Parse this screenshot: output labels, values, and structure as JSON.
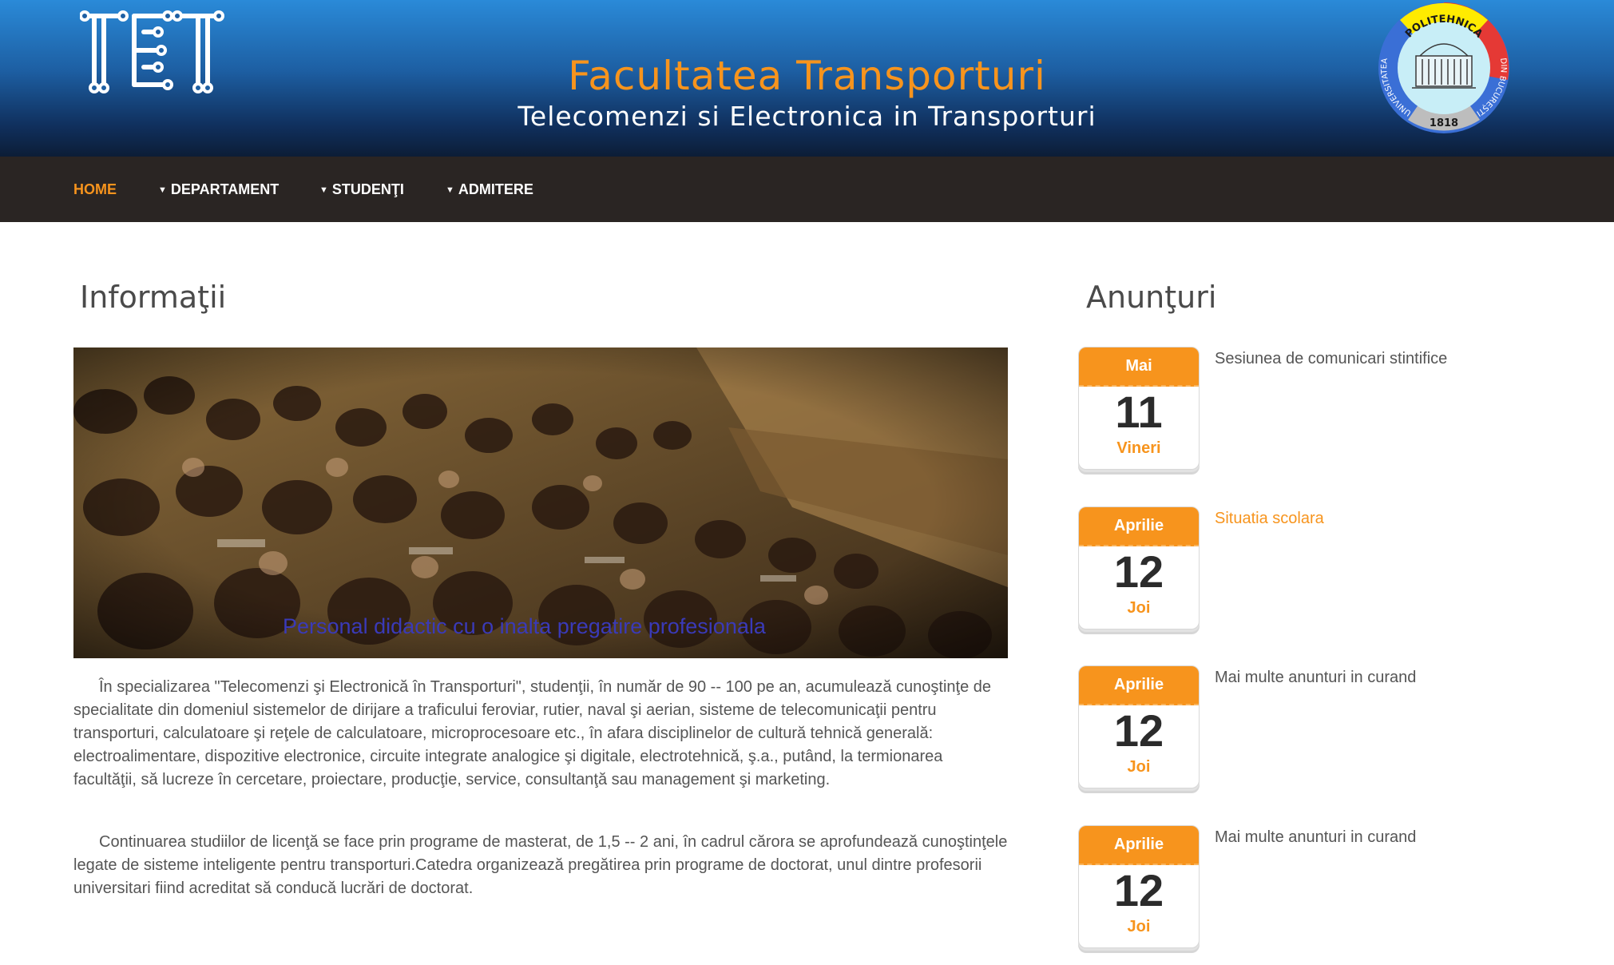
{
  "header": {
    "title": "Facultatea Transporturi",
    "subtitle": "Telecomenzi si Electronica in Transporturi",
    "seal": {
      "top_text": "POLITEHNICA",
      "left_text": "UNIVERSITATEA",
      "right_text": "DIN BUCUREȘTI",
      "year": "1818"
    }
  },
  "nav": {
    "items": [
      {
        "label": "HOME",
        "active": true
      },
      {
        "label": "DEPARTAMENT",
        "caret": true
      },
      {
        "label": "STUDENŢI",
        "caret": true
      },
      {
        "label": "ADMITERE",
        "caret": true
      }
    ]
  },
  "main": {
    "title": "Informaţii",
    "hero_caption": "Personal didactic cu o inalta pregatire profesionala",
    "paragraphs": [
      "În specializarea \"Telecomenzi şi Electronică în Transporturi\", studenţii, în număr de 90 -- 100 pe an, acumulează cunoştinţe de specialitate din domeniul sistemelor de dirijare a traficului feroviar, rutier, naval şi aerian, sisteme de telecomunicaţii pentru transporturi, calculatoare şi reţele de calculatoare, microprocesoare etc., în afara disciplinelor de cultură tehnică generală: electroalimentare, dispozitive electronice, circuite integrate analogice şi digitale, electrotehnică, ş.a., putând, la termionarea facultăţii, să lucreze în cercetare, proiectare, producţie, service, consultanţă sau management şi marketing.",
      "Continuarea studiilor de licenţă se face prin programe de masterat, de 1,5 -- 2 ani, în cadrul cărora se aprofundează cunoştinţele legate de sisteme inteligente pentru transporturi.Catedra organizează pregătirea prin programe de doctorat, unul dintre profesorii universitari fiind acreditat să conducă lucrări de doctorat."
    ]
  },
  "sidebar": {
    "title": "Anunţuri",
    "announcements": [
      {
        "month": "Mai",
        "day": "11",
        "weekday": "Vineri",
        "text": "Sesiunea de comunicari stintifice"
      },
      {
        "month": "Aprilie",
        "day": "12",
        "weekday": "Joi",
        "text": "Situatia scolara"
      },
      {
        "month": "Aprilie",
        "day": "12",
        "weekday": "Joi",
        "text": "Mai multe anunturi in curand"
      },
      {
        "month": "Aprilie",
        "day": "12",
        "weekday": "Joi",
        "text": "Mai multe anunturi in curand"
      }
    ]
  },
  "colors": {
    "accent": "#f7941d",
    "nav_bg": "#2a2523",
    "header_top": "#2a8ad8",
    "header_bottom": "#0c1d36",
    "caption": "#3a3ab8"
  }
}
